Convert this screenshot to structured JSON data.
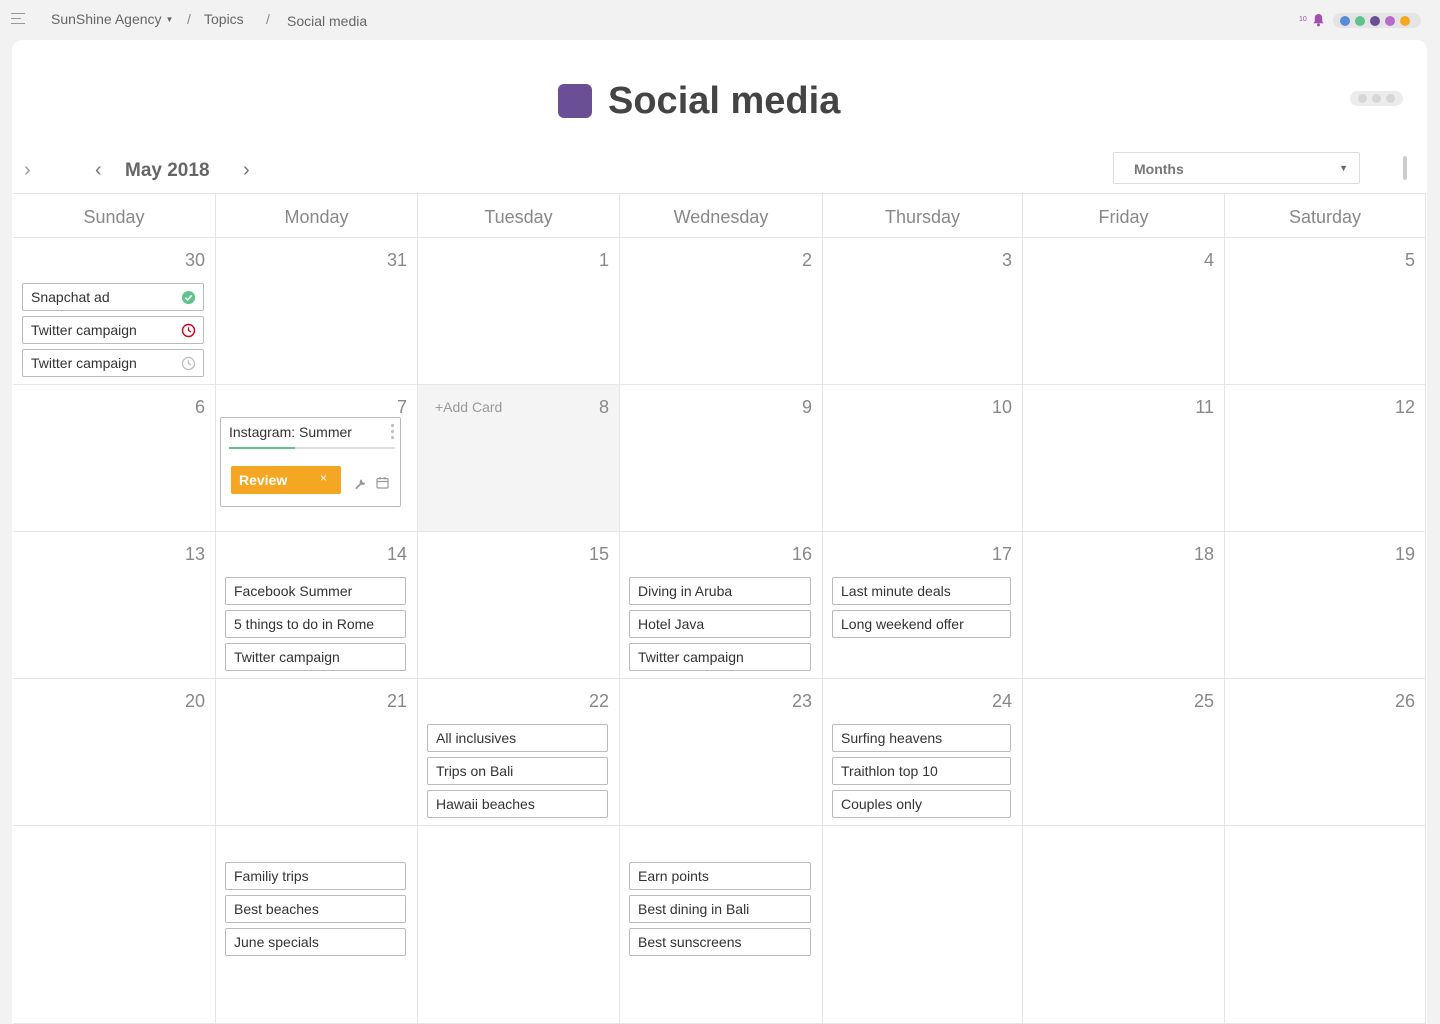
{
  "breadcrumb": {
    "workspace": "SunShine Agency",
    "separator": "/",
    "topics": "Topics",
    "current": "Social media"
  },
  "notifications": {
    "count": "10",
    "icon": "bell-icon"
  },
  "user_dots": [
    "#5b8bd6",
    "#5ec38a",
    "#6a4f96",
    "#b86bc9",
    "#f5a623"
  ],
  "page": {
    "title": "Social media",
    "accent": "#6a4f96"
  },
  "nav": {
    "month": "May 2018",
    "view": "Months",
    "prev_glyph": "‹",
    "next_glyph": "›",
    "side_glyph": "›"
  },
  "weekdays": [
    "Sunday",
    "Monday",
    "Tuesday",
    "Wednesday",
    "Thursday",
    "Friday",
    "Saturday"
  ],
  "add_card_label": "+Add Card",
  "days": [
    {
      "num": "30",
      "cards": [
        {
          "label": "Snapchat ad",
          "status": "done"
        },
        {
          "label": "Twitter campaign",
          "status": "overdue"
        },
        {
          "label": "Twitter campaign",
          "status": "scheduled"
        }
      ]
    },
    {
      "num": "31",
      "cards": []
    },
    {
      "num": "1",
      "cards": []
    },
    {
      "num": "2",
      "cards": []
    },
    {
      "num": "3",
      "cards": []
    },
    {
      "num": "4",
      "cards": []
    },
    {
      "num": "5",
      "cards": []
    },
    {
      "num": "6",
      "cards": []
    },
    {
      "num": "7",
      "expanded": {
        "title": "Instagram: Summer",
        "progress": 0.4,
        "tag": "Review",
        "tag_close": "×",
        "tag_color": "#f5a623"
      },
      "cards": []
    },
    {
      "num": "8",
      "active": true,
      "cards": []
    },
    {
      "num": "9",
      "cards": []
    },
    {
      "num": "10",
      "cards": []
    },
    {
      "num": "11",
      "cards": []
    },
    {
      "num": "12",
      "cards": []
    },
    {
      "num": "13",
      "cards": []
    },
    {
      "num": "14",
      "cards": [
        {
          "label": "Facebook Summer"
        },
        {
          "label": "5 things to do in Rome"
        },
        {
          "label": "Twitter campaign"
        }
      ]
    },
    {
      "num": "15",
      "cards": []
    },
    {
      "num": "16",
      "cards": [
        {
          "label": "Diving in Aruba"
        },
        {
          "label": "Hotel Java"
        },
        {
          "label": "Twitter campaign"
        }
      ]
    },
    {
      "num": "17",
      "cards": [
        {
          "label": "Last minute deals"
        },
        {
          "label": "Long weekend offer"
        }
      ]
    },
    {
      "num": "18",
      "cards": []
    },
    {
      "num": "19",
      "cards": []
    },
    {
      "num": "20",
      "cards": []
    },
    {
      "num": "21",
      "cards": []
    },
    {
      "num": "22",
      "cards": [
        {
          "label": "All inclusives"
        },
        {
          "label": "Trips on Bali"
        },
        {
          "label": "Hawaii beaches"
        }
      ]
    },
    {
      "num": "23",
      "cards": []
    },
    {
      "num": "24",
      "cards": [
        {
          "label": "Surfing heavens"
        },
        {
          "label": "Traithlon top 10"
        },
        {
          "label": "Couples only"
        }
      ]
    },
    {
      "num": "25",
      "cards": []
    },
    {
      "num": "26",
      "cards": []
    },
    {
      "num": "",
      "cards": []
    },
    {
      "num": "",
      "cards": [
        {
          "label": "Familiy trips"
        },
        {
          "label": "Best beaches"
        },
        {
          "label": "June specials"
        }
      ]
    },
    {
      "num": "",
      "cards": []
    },
    {
      "num": "",
      "cards": [
        {
          "label": "Earn points"
        },
        {
          "label": "Best dining in Bali"
        },
        {
          "label": "Best sunscreens"
        }
      ]
    },
    {
      "num": "",
      "cards": []
    },
    {
      "num": "",
      "cards": []
    },
    {
      "num": "",
      "cards": []
    }
  ]
}
